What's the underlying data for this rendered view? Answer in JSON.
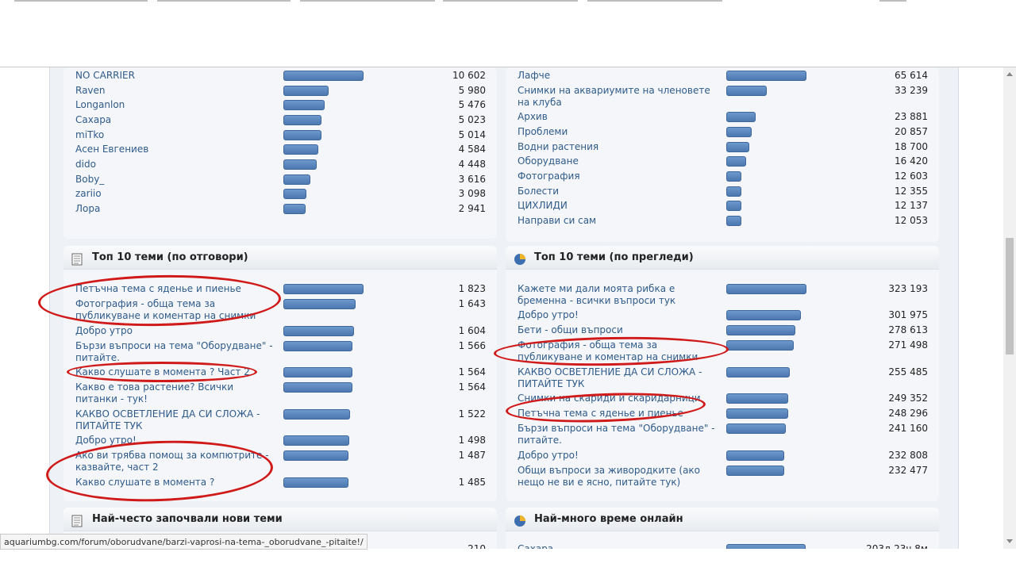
{
  "status_url": "aquariumbg.com/forum/oborudvane/barzi-vaprosi-na-tema-_oborudvane_-pitaite!/",
  "accent_color": "#4c78b0",
  "annotation_color": "#d01a1a",
  "top_posters": [
    {
      "name": "NO CARRIER",
      "value": "10 602",
      "fraction": 1.0
    },
    {
      "name": "Raven",
      "value": "5 980",
      "fraction": 0.564
    },
    {
      "name": "Longanlon",
      "value": "5 476",
      "fraction": 0.516
    },
    {
      "name": "Сахара",
      "value": "5 023",
      "fraction": 0.474
    },
    {
      "name": "miTko",
      "value": "5 014",
      "fraction": 0.473
    },
    {
      "name": "Асен Евгениев",
      "value": "4 584",
      "fraction": 0.432
    },
    {
      "name": "dido",
      "value": "4 448",
      "fraction": 0.42
    },
    {
      "name": "Boby_",
      "value": "3 616",
      "fraction": 0.341
    },
    {
      "name": "zariio",
      "value": "3 098",
      "fraction": 0.292
    },
    {
      "name": "Лора",
      "value": "2 941",
      "fraction": 0.277
    }
  ],
  "top_boards": [
    {
      "name": "Лафче",
      "value": "65 614",
      "fraction": 1.0
    },
    {
      "name": "Снимки на аквариумите на членовете на клуба",
      "value": "33 239",
      "fraction": 0.507
    },
    {
      "name": "Архив",
      "value": "23 881",
      "fraction": 0.364
    },
    {
      "name": "Проблеми",
      "value": "20 857",
      "fraction": 0.318
    },
    {
      "name": "Водни растения",
      "value": "18 700",
      "fraction": 0.285
    },
    {
      "name": "Оборудване",
      "value": "16 420",
      "fraction": 0.25
    },
    {
      "name": "Фотография",
      "value": "12 603",
      "fraction": 0.192
    },
    {
      "name": "Болести",
      "value": "12 355",
      "fraction": 0.188
    },
    {
      "name": "ЦИХЛИДИ",
      "value": "12 137",
      "fraction": 0.185
    },
    {
      "name": "Направи си сам",
      "value": "12 053",
      "fraction": 0.184
    }
  ],
  "top_topics_replies": {
    "title": "Топ 10 теми (по отговори)",
    "items": [
      {
        "name": "Петъчна тема с яденье и пиенье",
        "value": "1 823",
        "fraction": 1.0
      },
      {
        "name": "Фотография - обща тема за публикуване и коментар на снимки",
        "value": "1 643",
        "fraction": 0.9
      },
      {
        "name": "Добро утро",
        "value": "1 604",
        "fraction": 0.88
      },
      {
        "name": "Бързи въпроси на тема \"Оборудване\" - питайте.",
        "value": "1 566",
        "fraction": 0.86
      },
      {
        "name": "Какво слушате в момента ? Част 2",
        "value": "1 564",
        "fraction": 0.86
      },
      {
        "name": "Какво е това растение? Всички питанки - тук!",
        "value": "1 564",
        "fraction": 0.86
      },
      {
        "name": "КАКВО ОСВЕТЛЕНИЕ ДА СИ СЛОЖА - ПИТАЙТЕ ТУК",
        "value": "1 522",
        "fraction": 0.835
      },
      {
        "name": "Добро утро!",
        "value": "1 498",
        "fraction": 0.82
      },
      {
        "name": "Ако ви трябва помощ за компютрите - казвайте, част 2",
        "value": "1 487",
        "fraction": 0.816
      },
      {
        "name": "Какво слушате в момента ?",
        "value": "1 485",
        "fraction": 0.815
      }
    ]
  },
  "top_topics_views": {
    "title": "Топ 10 теми (по прегледи)",
    "items": [
      {
        "name": "Кажете ми дали моята рибка е бременна - всички въпроси тук",
        "value": "323 193",
        "fraction": 1.0
      },
      {
        "name": "Добро утро!",
        "value": "301 975",
        "fraction": 0.934
      },
      {
        "name": "Бети - общи въпроси",
        "value": "278 613",
        "fraction": 0.862
      },
      {
        "name": "Фотография - обща тема за публикуване и коментар на снимки",
        "value": "271 498",
        "fraction": 0.84
      },
      {
        "name": "КАКВО ОСВЕТЛЕНИЕ ДА СИ СЛОЖА - ПИТАЙТЕ ТУК",
        "value": "255 485",
        "fraction": 0.79
      },
      {
        "name": "Снимки на скариди и скаридарници",
        "value": "249 352",
        "fraction": 0.77
      },
      {
        "name": "Петъчна тема с яденье и пиенье",
        "value": "248 296",
        "fraction": 0.768
      },
      {
        "name": "Бързи въпроси на тема \"Оборудване\" - питайте.",
        "value": "241 160",
        "fraction": 0.746
      },
      {
        "name": "Добро утро!",
        "value": "232 808",
        "fraction": 0.72
      },
      {
        "name": "Общи въпроси за живородките (ако нещо не ви е ясно, питайте тук)",
        "value": "232 477",
        "fraction": 0.719
      }
    ]
  },
  "next_sections": {
    "left_title": "Най-често започвали нови теми",
    "right_title": "Най-много време онлайн",
    "left_partial_value": "210",
    "right_partial_name": "Сахара",
    "right_partial_value": "203д 23ч 8м"
  }
}
